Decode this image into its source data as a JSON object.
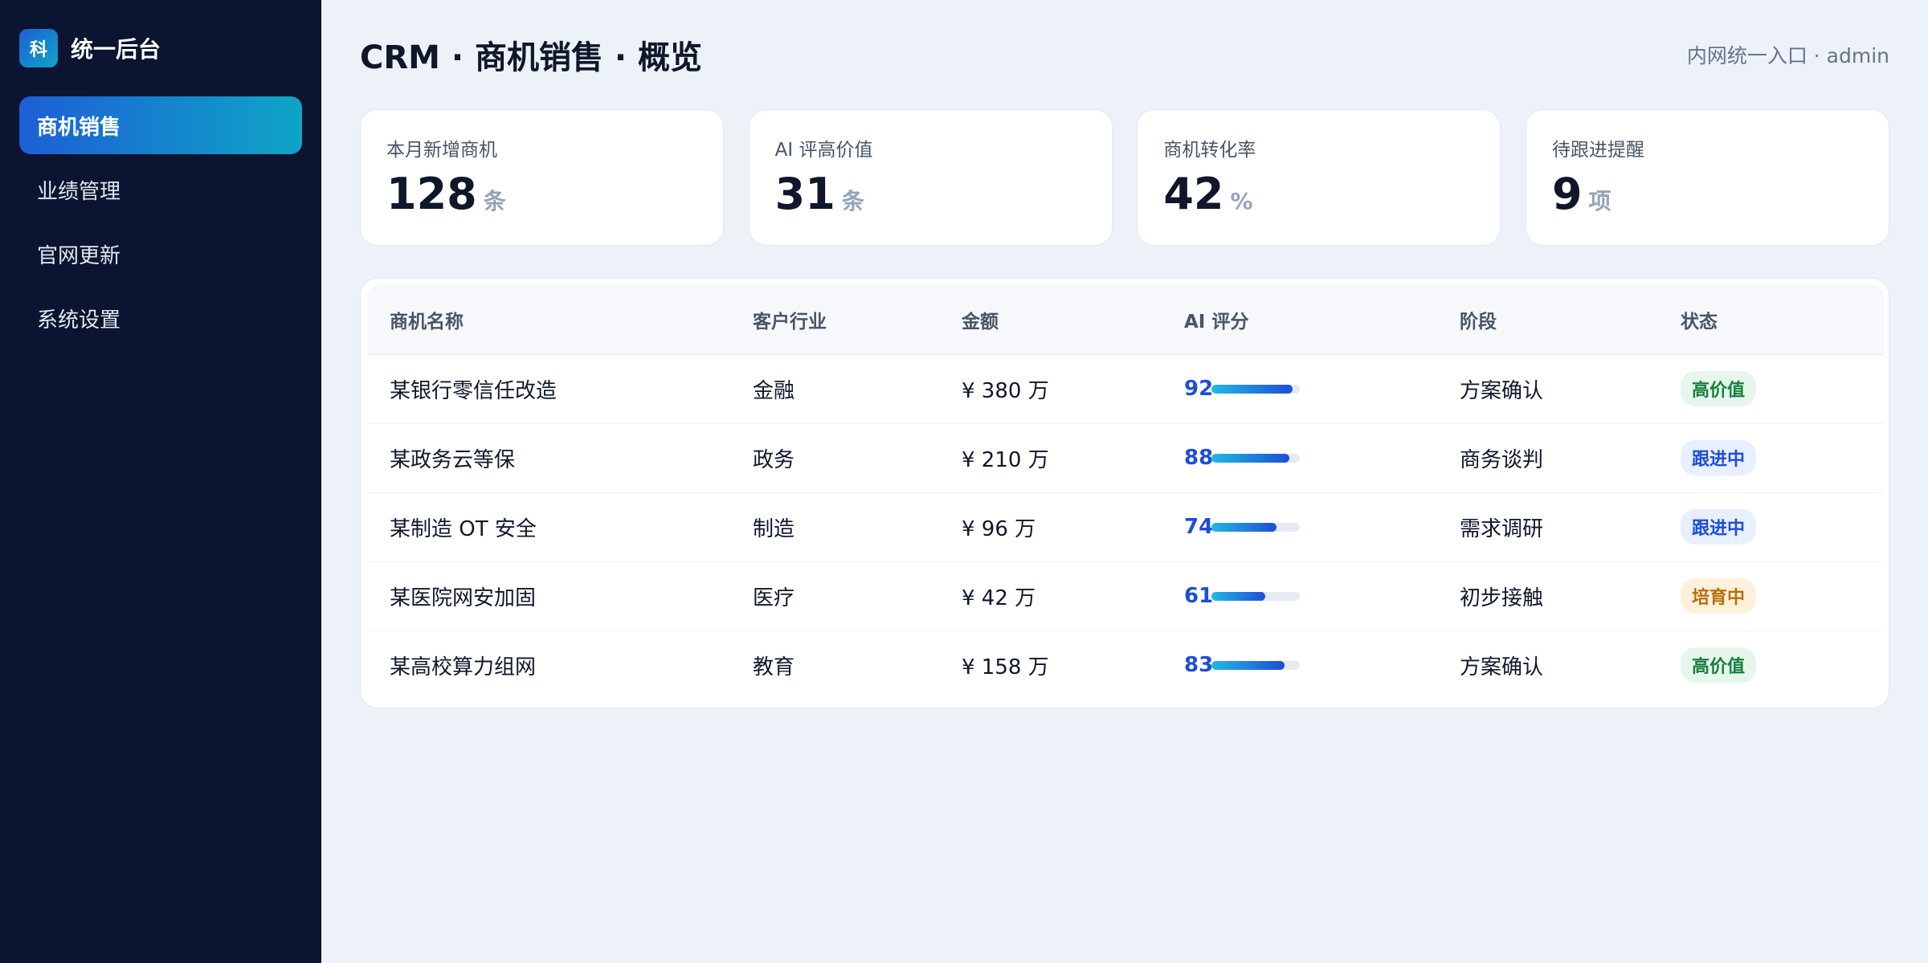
{
  "app": {
    "logo_text": "科",
    "name": "统一后台"
  },
  "sidebar": {
    "items": [
      {
        "label": "商机销售",
        "active": true
      },
      {
        "label": "业绩管理",
        "active": false
      },
      {
        "label": "官网更新",
        "active": false
      },
      {
        "label": "系统设置",
        "active": false
      }
    ]
  },
  "header": {
    "title": "CRM · 商机销售 · 概览",
    "user": "内网统一入口 · admin"
  },
  "stats": [
    {
      "label": "本月新增商机",
      "value": "128",
      "unit": "条"
    },
    {
      "label": "AI 评高价值",
      "value": "31",
      "unit": "条"
    },
    {
      "label": "商机转化率",
      "value": "42",
      "unit": "%"
    },
    {
      "label": "待跟进提醒",
      "value": "9",
      "unit": "项"
    }
  ],
  "table": {
    "columns": [
      "商机名称",
      "客户行业",
      "金额",
      "AI 评分",
      "阶段",
      "状态"
    ],
    "rows": [
      {
        "name": "某银行零信任改造",
        "industry": "金融",
        "amount": "¥ 380 万",
        "score": 92,
        "stage": "方案确认",
        "status": "高价值",
        "status_type": "high"
      },
      {
        "name": "某政务云等保",
        "industry": "政务",
        "amount": "¥ 210 万",
        "score": 88,
        "stage": "商务谈判",
        "status": "跟进中",
        "status_type": "follow"
      },
      {
        "name": "某制造 OT 安全",
        "industry": "制造",
        "amount": "¥ 96 万",
        "score": 74,
        "stage": "需求调研",
        "status": "跟进中",
        "status_type": "follow"
      },
      {
        "name": "某医院网安加固",
        "industry": "医疗",
        "amount": "¥ 42 万",
        "score": 61,
        "stage": "初步接触",
        "status": "培育中",
        "status_type": "nurture"
      },
      {
        "name": "某高校算力组网",
        "industry": "教育",
        "amount": "¥ 158 万",
        "score": 83,
        "stage": "方案确认",
        "status": "高价值",
        "status_type": "high"
      }
    ]
  },
  "colors": {
    "sidebar_bg": "#0b1430",
    "accent_start": "#1d5fd6",
    "accent_end": "#0ea5c6",
    "status_high_bg": "#e7f6ec",
    "status_high_fg": "#15803d",
    "status_follow_bg": "#e8efff",
    "status_follow_fg": "#1d4ed8",
    "status_nurture_bg": "#fdf1dc",
    "status_nurture_fg": "#b86e0b"
  }
}
